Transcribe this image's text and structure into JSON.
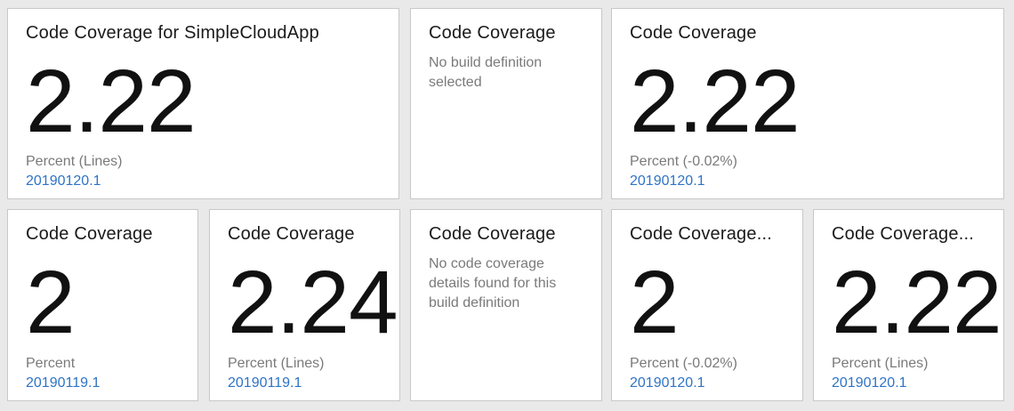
{
  "tiles": [
    {
      "title": "Code Coverage for SimpleCloudApp",
      "value": "2.22",
      "label": "Percent (Lines)",
      "link": "20190120.1"
    },
    {
      "title": "Code Coverage",
      "message": "No build definition selected"
    },
    {
      "title": "Code Coverage",
      "value": "2.22",
      "label": "Percent (-0.02%)",
      "link": "20190120.1"
    },
    {
      "title": "Code Coverage",
      "value": "2",
      "label": "Percent",
      "link": "20190119.1"
    },
    {
      "title": "Code Coverage",
      "value": "2.24",
      "label": "Percent (Lines)",
      "link": "20190119.1"
    },
    {
      "title": "Code Coverage",
      "message": "No code coverage details found for this build definition"
    },
    {
      "title": "Code Coverage...",
      "value": "2",
      "label": "Percent (-0.02%)",
      "link": "20190120.1"
    },
    {
      "title": "Code Coverage...",
      "value": "2.22",
      "label": "Percent (Lines)",
      "link": "20190120.1"
    }
  ]
}
